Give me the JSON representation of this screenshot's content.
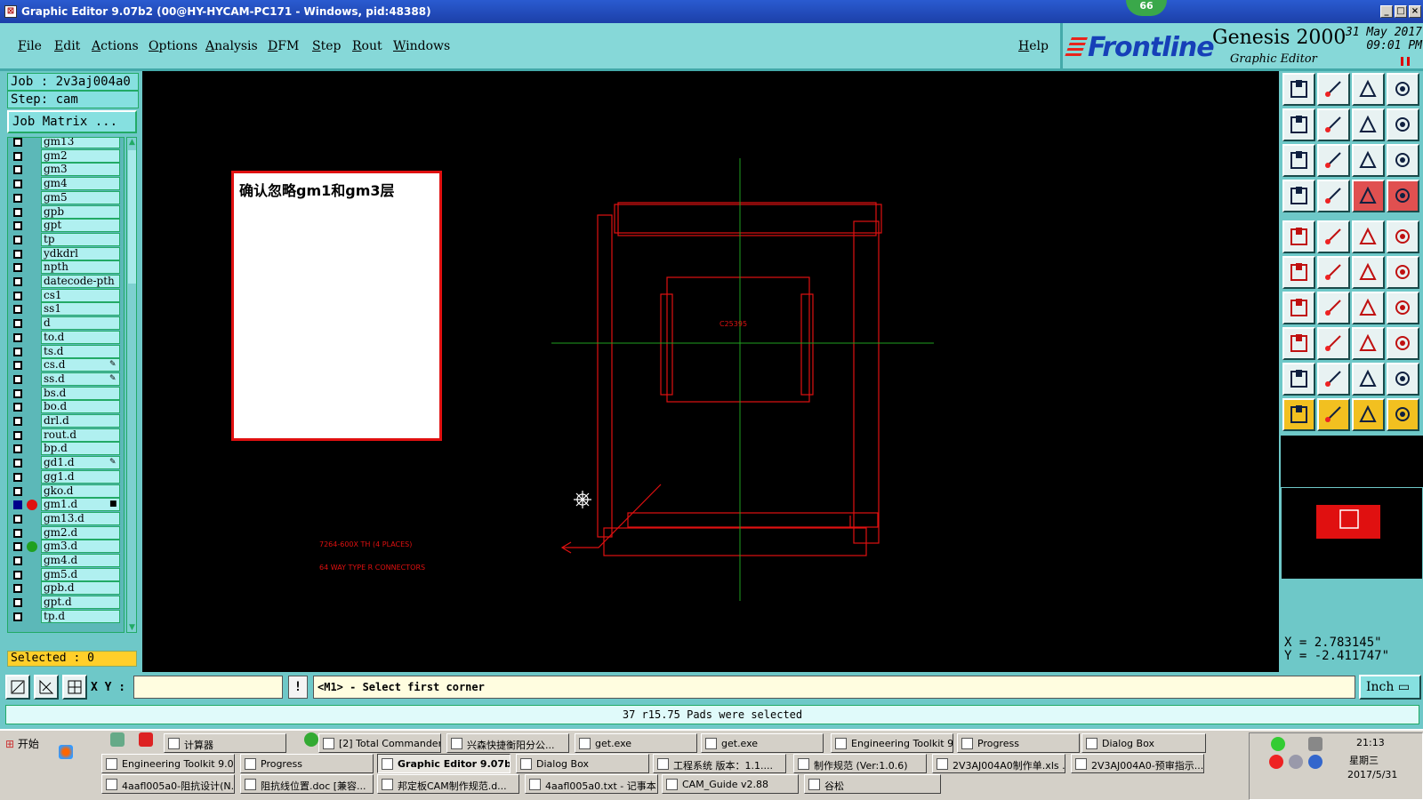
{
  "window": {
    "title": "Graphic Editor 9.07b2 (00@HY-HYCAM-PC171 - Windows, pid:48388)",
    "badge": "66"
  },
  "menu": {
    "items": [
      "File",
      "Edit",
      "Actions",
      "Options",
      "Analysis",
      "DFM",
      "Step",
      "Rout",
      "Windows"
    ],
    "help": "Help"
  },
  "brand": {
    "logo": "Frontline",
    "product": "Genesis 2000",
    "subtitle": "Graphic Editor",
    "date": "31 May 2017",
    "time": "09:01 PM"
  },
  "left_panel": {
    "job": "Job : 2v3aj004a0",
    "step": "Step: cam",
    "job_matrix": "Job Matrix ...",
    "layers": [
      {
        "name": "gm13"
      },
      {
        "name": "gm2"
      },
      {
        "name": "gm3"
      },
      {
        "name": "gm4"
      },
      {
        "name": "gm5"
      },
      {
        "name": "gpb"
      },
      {
        "name": "gpt"
      },
      {
        "name": "tp"
      },
      {
        "name": "ydkdrl"
      },
      {
        "name": "npth"
      },
      {
        "name": "datecode-pth"
      },
      {
        "name": "cs1"
      },
      {
        "name": "ss1"
      },
      {
        "name": "d"
      },
      {
        "name": "to.d"
      },
      {
        "name": "ts.d"
      },
      {
        "name": "cs.d",
        "marker": "✎"
      },
      {
        "name": "ss.d",
        "marker": "✎"
      },
      {
        "name": "bs.d"
      },
      {
        "name": "bo.d"
      },
      {
        "name": "drl.d"
      },
      {
        "name": "rout.d"
      },
      {
        "name": "bp.d"
      },
      {
        "name": "gd1.d",
        "marker": "✎"
      },
      {
        "name": "gg1.d"
      },
      {
        "name": "gko.d"
      },
      {
        "name": "gm1.d",
        "checked": true,
        "dot": "#e01010",
        "marker": "■"
      },
      {
        "name": "gm13.d"
      },
      {
        "name": "gm2.d"
      },
      {
        "name": "gm3.d",
        "dot": "#20a020"
      },
      {
        "name": "gm4.d"
      },
      {
        "name": "gm5.d"
      },
      {
        "name": "gpb.d"
      },
      {
        "name": "gpt.d"
      },
      {
        "name": "tp.d"
      }
    ],
    "selected": "Selected : 0"
  },
  "canvas": {
    "note": "确认忽略gm1和gm3层",
    "component_label": "C25395",
    "annotation_1": "7264-600X TH (4 PLACES)",
    "annotation_2": "64 WAY TYPE R CONNECTORS",
    "colors": {
      "outline": "#e01010",
      "crosshair": "#20a020",
      "background": "#000000"
    }
  },
  "coords": {
    "x": "X = 2.783145\"",
    "y": "Y = -2.411747\""
  },
  "bottom": {
    "xy_label": "X Y :",
    "xy_value": "",
    "excl": "!",
    "prompt": "<M1> - Select first corner",
    "units": "Inch"
  },
  "status": "37 r15.75 Pads were selected",
  "taskbar": {
    "start": "开始",
    "row1": [
      "计算器",
      "[2] Total Commander ...",
      "兴森快捷衡阳分公...",
      "get.exe",
      "get.exe",
      "Engineering Toolkit 9....",
      "Progress",
      "Dialog Box"
    ],
    "row2": [
      "Engineering Toolkit 9.07...",
      "Progress",
      "Graphic Editor 9.07b2...",
      "Dialog Box",
      "工程系统  版本：1.1....",
      "制作规范 (Ver:1.0.6)",
      "2V3AJ004A0制作单.xls ...",
      "2V3AJ004A0-预审指示...."
    ],
    "row3": [
      "4aafl005a0-阻抗设计(N...",
      "阻抗线位置.doc [兼容...",
      "邦定板CAM制作规范.d...",
      "4aafl005a0.txt - 记事本",
      "CAM_Guide v2.88",
      "谷松"
    ],
    "clock_time": "21:13",
    "weekday": "星期三",
    "date": "2017/5/31"
  }
}
